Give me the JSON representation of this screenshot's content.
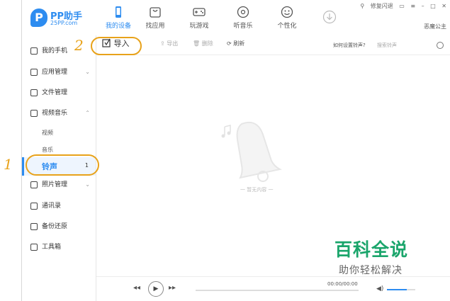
{
  "app": {
    "logo_name": "PP助手",
    "logo_sub": "25PP.com"
  },
  "nav": [
    {
      "label": "我的设备",
      "icon": "phone-icon",
      "active": true
    },
    {
      "label": "找应用",
      "icon": "bag-icon",
      "active": false
    },
    {
      "label": "玩游戏",
      "icon": "gamepad-icon",
      "active": false
    },
    {
      "label": "听音乐",
      "icon": "music-disc-icon",
      "active": false
    },
    {
      "label": "个性化",
      "icon": "smiley-icon",
      "active": false
    }
  ],
  "window_tools": {
    "repair": "修复闪退",
    "user": "恶魔公主"
  },
  "sidebar": {
    "items": [
      {
        "label": "我的手机",
        "icon": "phone-icon"
      },
      {
        "label": "应用管理",
        "icon": "apps-icon",
        "chev": "⌄"
      },
      {
        "label": "文件管理",
        "icon": "folder-icon"
      },
      {
        "label": "视频音乐",
        "icon": "video-icon",
        "chev": "⌃"
      },
      {
        "label": "照片管理",
        "icon": "photo-icon",
        "chev": "⌄"
      },
      {
        "label": "通讯录",
        "icon": "contacts-icon"
      },
      {
        "label": "备份还原",
        "icon": "backup-icon"
      },
      {
        "label": "工具箱",
        "icon": "toolbox-icon"
      }
    ],
    "sub_items": [
      "视频",
      "音乐"
    ],
    "active": {
      "label": "铃声",
      "count": "1"
    }
  },
  "toolbar": {
    "import": "导入",
    "export": "导出",
    "delete": "删除",
    "refresh": "刷新",
    "help_link": "如何设置铃声?",
    "search_placeholder": "搜索铃声"
  },
  "main": {
    "empty_text": "一 暂无内容 一"
  },
  "player": {
    "time": "00:00/00:00",
    "volume_level": 0.7
  },
  "annotations": [
    "1",
    "2"
  ],
  "watermark": {
    "title": "百科全说",
    "subtitle": "助你轻松解决"
  },
  "colors": {
    "accent": "#2d8cf0",
    "annotation": "#e8a21a",
    "watermark": "#1aa56b"
  }
}
